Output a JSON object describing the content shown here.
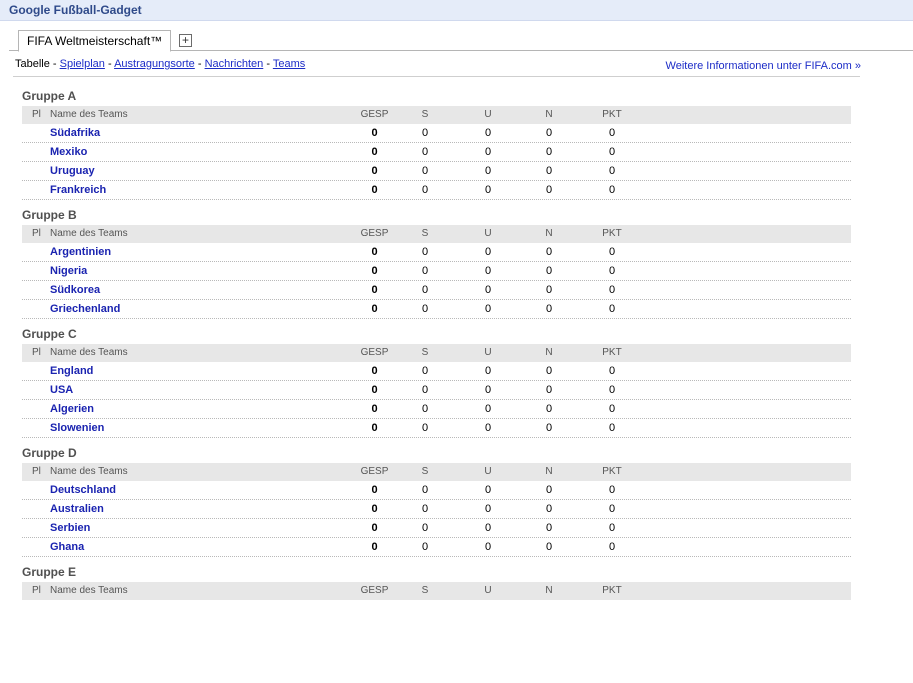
{
  "app": {
    "title": "Google Fußball-Gadget"
  },
  "tabs": {
    "active_label": "FIFA Weltmeisterschaft™",
    "add_symbol": "+"
  },
  "nav": {
    "current": "Tabelle",
    "links": [
      "Spielplan",
      "Austragungsorte",
      "Nachrichten",
      "Teams"
    ],
    "separator": " - ",
    "more_link": "Weitere Informationen unter FIFA.com »"
  },
  "columns": {
    "pl": "Pl",
    "name": "Name des Teams",
    "gesp": "GESP",
    "s": "S",
    "u": "U",
    "n": "N",
    "pkt": "PKT"
  },
  "groups": [
    {
      "title": "Gruppe A",
      "teams": [
        {
          "name": "Südafrika",
          "gesp": "0",
          "s": "0",
          "u": "0",
          "n": "0",
          "pkt": "0"
        },
        {
          "name": "Mexiko",
          "gesp": "0",
          "s": "0",
          "u": "0",
          "n": "0",
          "pkt": "0"
        },
        {
          "name": "Uruguay",
          "gesp": "0",
          "s": "0",
          "u": "0",
          "n": "0",
          "pkt": "0"
        },
        {
          "name": "Frankreich",
          "gesp": "0",
          "s": "0",
          "u": "0",
          "n": "0",
          "pkt": "0"
        }
      ]
    },
    {
      "title": "Gruppe B",
      "teams": [
        {
          "name": "Argentinien",
          "gesp": "0",
          "s": "0",
          "u": "0",
          "n": "0",
          "pkt": "0"
        },
        {
          "name": "Nigeria",
          "gesp": "0",
          "s": "0",
          "u": "0",
          "n": "0",
          "pkt": "0"
        },
        {
          "name": "Südkorea",
          "gesp": "0",
          "s": "0",
          "u": "0",
          "n": "0",
          "pkt": "0"
        },
        {
          "name": "Griechenland",
          "gesp": "0",
          "s": "0",
          "u": "0",
          "n": "0",
          "pkt": "0"
        }
      ]
    },
    {
      "title": "Gruppe C",
      "teams": [
        {
          "name": "England",
          "gesp": "0",
          "s": "0",
          "u": "0",
          "n": "0",
          "pkt": "0"
        },
        {
          "name": "USA",
          "gesp": "0",
          "s": "0",
          "u": "0",
          "n": "0",
          "pkt": "0"
        },
        {
          "name": "Algerien",
          "gesp": "0",
          "s": "0",
          "u": "0",
          "n": "0",
          "pkt": "0"
        },
        {
          "name": "Slowenien",
          "gesp": "0",
          "s": "0",
          "u": "0",
          "n": "0",
          "pkt": "0"
        }
      ]
    },
    {
      "title": "Gruppe D",
      "teams": [
        {
          "name": "Deutschland",
          "gesp": "0",
          "s": "0",
          "u": "0",
          "n": "0",
          "pkt": "0"
        },
        {
          "name": "Australien",
          "gesp": "0",
          "s": "0",
          "u": "0",
          "n": "0",
          "pkt": "0"
        },
        {
          "name": "Serbien",
          "gesp": "0",
          "s": "0",
          "u": "0",
          "n": "0",
          "pkt": "0"
        },
        {
          "name": "Ghana",
          "gesp": "0",
          "s": "0",
          "u": "0",
          "n": "0",
          "pkt": "0"
        }
      ]
    },
    {
      "title": "Gruppe E",
      "teams": []
    }
  ]
}
